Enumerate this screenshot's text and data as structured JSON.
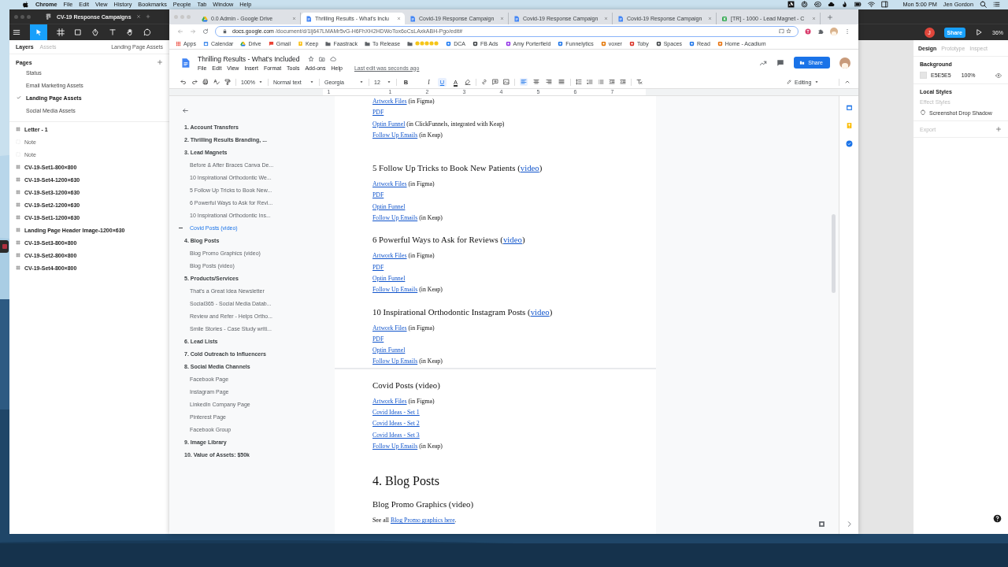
{
  "menu_bar": {
    "app": "Chrome",
    "menus": [
      "File",
      "Edit",
      "View",
      "History",
      "Bookmarks",
      "People",
      "Tab",
      "Window",
      "Help"
    ],
    "clock": "Mon 5:00 PM",
    "user": "Jen Gordon"
  },
  "figma": {
    "tab": "CV-19 Response Campaigns",
    "avatar": "J",
    "share": "Share",
    "zoom": "36%",
    "panel_tabs": [
      {
        "label": "Layers",
        "selected": true
      },
      {
        "label": "Assets",
        "selected": false
      }
    ],
    "page_menu": "Landing Page Assets",
    "pages_title": "Pages",
    "pages": [
      {
        "label": "Status",
        "selected": false
      },
      {
        "label": "Email Marketing Assets",
        "selected": false
      },
      {
        "label": "Landing Page Assets",
        "selected": true
      },
      {
        "label": "Social Media Assets",
        "selected": false
      }
    ],
    "layers": [
      {
        "label": "Letter - 1",
        "kind": "frame"
      },
      {
        "label": "Note",
        "kind": "note"
      },
      {
        "label": "Note",
        "kind": "note"
      },
      {
        "label": "CV-19-Set1-800×800",
        "kind": "frame"
      },
      {
        "label": "CV-19-Set4-1200×630",
        "kind": "frame"
      },
      {
        "label": "CV-19-Set3-1200×630",
        "kind": "frame"
      },
      {
        "label": "CV-19-Set2-1200×630",
        "kind": "frame"
      },
      {
        "label": "CV-19-Set1-1200×630",
        "kind": "frame"
      },
      {
        "label": "Landing Page Header Image-1200×630",
        "kind": "frame"
      },
      {
        "label": "CV-19-Set3-800×800",
        "kind": "frame"
      },
      {
        "label": "CV-19-Set2-800×800",
        "kind": "frame"
      },
      {
        "label": "CV-19-Set4-800×800",
        "kind": "frame"
      }
    ],
    "inspector_tabs": [
      {
        "label": "Design",
        "selected": true
      },
      {
        "label": "Prototype",
        "selected": false
      },
      {
        "label": "Inspect",
        "selected": false
      }
    ],
    "background": {
      "title": "Background",
      "hex": "E5E5E5",
      "opacity": "100%"
    },
    "local_styles": {
      "title": "Local Styles",
      "group": "Effect Styles",
      "items": [
        "Screenshot Drop Shadow"
      ]
    },
    "export": "Export"
  },
  "chrome": {
    "tabs": [
      {
        "title": "0.0 Admin - Google Drive",
        "kind": "drive",
        "selected": false
      },
      {
        "title": "Thrilling Results - What's Inclu",
        "kind": "docs",
        "selected": true
      },
      {
        "title": "Covid-19 Response Campaign",
        "kind": "docs",
        "selected": false
      },
      {
        "title": "Covid-19 Response Campaign",
        "kind": "docs",
        "selected": false
      },
      {
        "title": "Covid-19 Response Campaign",
        "kind": "docs",
        "selected": false
      },
      {
        "title": "[TR] - 1000 - Lead Magnet - C",
        "kind": "k",
        "selected": false
      }
    ],
    "url_host": "docs.google.com",
    "url_path": "/document/d/1lj647LMAMr5vG-H6FhXH2HDWoTox6oCsLAxkABH-Pgo/edit#",
    "bookmarks": [
      {
        "label": "Apps",
        "kind": "apps"
      },
      {
        "label": "Calendar",
        "kind": "site"
      },
      {
        "label": "Drive",
        "kind": "site"
      },
      {
        "label": "Gmail",
        "kind": "site"
      },
      {
        "label": "Keep",
        "kind": "site"
      },
      {
        "label": "Faastrack",
        "kind": "folder"
      },
      {
        "label": "To Release",
        "kind": "folder"
      },
      {
        "kind": "emoji"
      },
      {
        "label": "DCA",
        "kind": "site"
      },
      {
        "label": "FB Ads",
        "kind": "site"
      },
      {
        "label": "Amy Porterfield",
        "kind": "site"
      },
      {
        "label": "Funnelytics",
        "kind": "site"
      },
      {
        "label": "voxer",
        "kind": "site"
      },
      {
        "label": "Toby",
        "kind": "site"
      },
      {
        "label": "Spaces",
        "kind": "site"
      },
      {
        "label": "Read",
        "kind": "site"
      },
      {
        "label": "Home - Acadium",
        "kind": "site"
      }
    ]
  },
  "doc": {
    "title": "Thrilling Results - What's Included",
    "menus": [
      "File",
      "Edit",
      "View",
      "Insert",
      "Format",
      "Tools",
      "Add-ons",
      "Help"
    ],
    "last_edit": "Last edit was seconds ago",
    "share": "Share",
    "toolbar": {
      "zoom": "100%",
      "style": "Normal text",
      "font": "Georgia",
      "size": "12",
      "format": [
        {
          "label": "B",
          "on": false
        },
        {
          "label": "I",
          "on": false
        },
        {
          "label": "U",
          "on": true
        },
        {
          "label": "A",
          "on": false
        }
      ],
      "alignment": [
        {
          "selected": true
        },
        {
          "selected": false
        },
        {
          "selected": false
        },
        {
          "selected": false
        }
      ],
      "mode": "Editing"
    },
    "ruler": [
      "1",
      "1",
      "2",
      "3",
      "4",
      "5",
      "6",
      "7"
    ],
    "outline": [
      {
        "label": "1. Account Transfers",
        "selected": false
      },
      {
        "label": "2. Thrilling Results Branding, ...",
        "selected": false
      },
      {
        "label": "3. Lead Magnets",
        "selected": false,
        "children": [
          {
            "label": "Before & After Braces Canva De...",
            "selected": false
          },
          {
            "label": "10 Inspirational Orthodontic We...",
            "selected": false
          },
          {
            "label": "5 Follow Up Tricks to Book New...",
            "selected": false
          },
          {
            "label": "6 Powerful Ways to Ask for Revi...",
            "selected": false
          },
          {
            "label": "10 Inspirational Orthodontic Ins...",
            "selected": false
          },
          {
            "label": "Covid Posts (video)",
            "selected": true
          }
        ]
      },
      {
        "label": "4. Blog Posts",
        "selected": false,
        "children": [
          {
            "label": "Blog Promo Graphics (video)",
            "selected": false
          },
          {
            "label": "Blog Posts (video)",
            "selected": false
          }
        ]
      },
      {
        "label": "5. Products/Services",
        "selected": false,
        "children": [
          {
            "label": "That's a Great Idea Newsletter",
            "selected": false
          },
          {
            "label": "Social365 - Social Media Datab...",
            "selected": false
          },
          {
            "label": "Review and Refer - Helps Ortho...",
            "selected": false
          },
          {
            "label": "Smile Stories - Case Study writi...",
            "selected": false
          }
        ]
      },
      {
        "label": "6. Lead Lists",
        "selected": false
      },
      {
        "label": "7. Cold Outreach to Influencers",
        "selected": false
      },
      {
        "label": "8. Social Media Channels",
        "selected": false,
        "children": [
          {
            "label": "Facebook Page",
            "selected": false
          },
          {
            "label": "Instagram Page",
            "selected": false
          },
          {
            "label": "LinkedIn Company Page",
            "selected": false
          },
          {
            "label": "Pinterest Page",
            "selected": false
          },
          {
            "label": "Facebook Group",
            "selected": false
          }
        ]
      },
      {
        "label": "9. Image Library",
        "selected": false
      },
      {
        "label": "10. Value of Assets: $50k",
        "selected": false
      }
    ],
    "body": [
      {
        "kind": "line",
        "link": "Artwork Files",
        "after": " (in Figma)"
      },
      {
        "kind": "line",
        "link": "PDF"
      },
      {
        "kind": "line",
        "link": "Optin Funnel",
        "after": " (in ClickFunnels, integrated with Keap)"
      },
      {
        "kind": "line",
        "link": "Follow Up Emails",
        "after": " (in Keap)"
      },
      {
        "kind": "blank"
      },
      {
        "kind": "heading",
        "before": "5 Follow Up Tricks to Book New Patients (",
        "link": "video",
        "after": ")"
      },
      {
        "kind": "line",
        "link": "Artwork Files",
        "after": " (in Figma)"
      },
      {
        "kind": "line",
        "link": "PDF"
      },
      {
        "kind": "line",
        "link": "Optin Funnel"
      },
      {
        "kind": "line",
        "link": "Follow Up Emails",
        "after": " (in Keap)"
      },
      {
        "kind": "heading",
        "before": "6 Powerful Ways to Ask for Reviews (",
        "link": "video",
        "after": ")"
      },
      {
        "kind": "line",
        "link": "Artwork Files",
        "after": " (in Figma)"
      },
      {
        "kind": "line",
        "link": "PDF"
      },
      {
        "kind": "line",
        "link": "Optin Funnel"
      },
      {
        "kind": "line",
        "link": "Follow Up Emails",
        "after": " (in Keap)"
      },
      {
        "kind": "heading",
        "before": "10 Inspirational Orthodontic Instagram Posts (",
        "link": "video",
        "after": ")"
      },
      {
        "kind": "line",
        "link": "Artwork Files",
        "after": " (in Figma)"
      },
      {
        "kind": "line",
        "link": "PDF"
      },
      {
        "kind": "line",
        "link": "Optin Funnel"
      },
      {
        "kind": "line",
        "link": "Follow Up Emails",
        "after": " (in Keap)"
      },
      {
        "kind": "page_break"
      },
      {
        "kind": "heading",
        "before": "Covid Posts (video)"
      },
      {
        "kind": "line",
        "link": "Artwork Files",
        "after": " (in Figma)"
      },
      {
        "kind": "line",
        "link": "Covid Ideas - Set 1"
      },
      {
        "kind": "line",
        "link": "Covid Ideas - Set 2"
      },
      {
        "kind": "line",
        "link": "Covid Ideas - Set 3"
      },
      {
        "kind": "line",
        "link": "Follow Up Emails",
        "after": " (in Keap)"
      },
      {
        "kind": "blank"
      },
      {
        "kind": "title",
        "before": "4. Blog Posts"
      },
      {
        "kind": "heading",
        "before": "Blog Promo Graphics (video)"
      },
      {
        "kind": "line",
        "before": "See all ",
        "link": "Blog Promo graphics here",
        "after": "."
      }
    ]
  }
}
